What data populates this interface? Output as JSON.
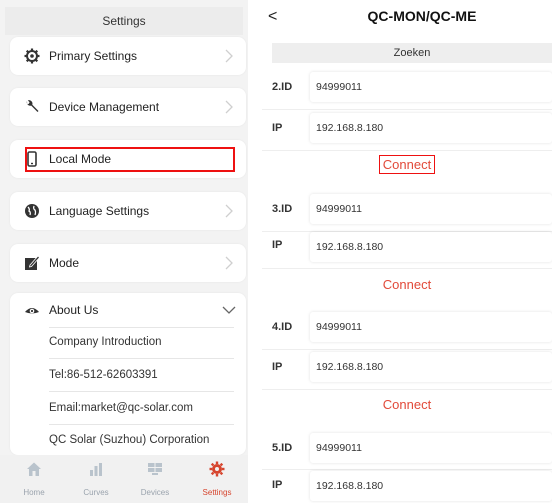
{
  "left": {
    "header": "Settings",
    "menu": [
      {
        "label": "Primary Settings",
        "icon": "gear-icon"
      },
      {
        "label": "Device Management",
        "icon": "wrench-icon"
      },
      {
        "label": "Local Mode",
        "icon": "phone-icon"
      },
      {
        "label": "Language Settings",
        "icon": "globe-icon"
      },
      {
        "label": "Mode",
        "icon": "mode-icon"
      },
      {
        "label": "About Us",
        "icon": "eye-icon"
      }
    ],
    "about_items": [
      "Company Introduction",
      "Tel:86-512-62603391",
      "Email:market@qc-solar.com",
      "QC Solar (Suzhou) Corporation"
    ],
    "tabs": [
      {
        "label": "Home",
        "icon": "home-icon"
      },
      {
        "label": "Curves",
        "icon": "curves-icon"
      },
      {
        "label": "Devices",
        "icon": "devices-icon"
      },
      {
        "label": "Settings",
        "icon": "settings-gear-icon"
      }
    ],
    "colors": {
      "accent": "#d6452e",
      "highlight_box": "#e11111"
    }
  },
  "right": {
    "title": "QC-MON/QC-ME",
    "back_glyph": "<",
    "search_label": "Zoeken",
    "devices": [
      {
        "id_label": "2.ID",
        "id": "94999011",
        "ip_label": "IP",
        "ip": "192.168.8.180",
        "connect": "Connect"
      },
      {
        "id_label": "3.ID",
        "id": "94999011",
        "ip_label": "IP",
        "ip": "192.168.8.180",
        "connect": "Connect"
      },
      {
        "id_label": "4.ID",
        "id": "94999011",
        "ip_label": "IP",
        "ip": "192.168.8.180",
        "connect": "Connect"
      },
      {
        "id_label": "5.ID",
        "id": "94999011",
        "ip_label": "IP",
        "ip": "192.168.8.180"
      }
    ],
    "colors": {
      "connect": "#e24a3a"
    }
  }
}
